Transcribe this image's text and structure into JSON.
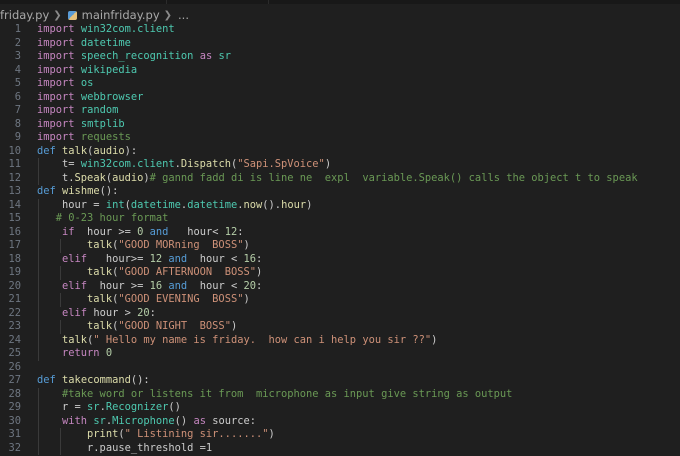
{
  "breadcrumb": {
    "folder": "friday.py",
    "file": "mainfriday.py",
    "more": "..."
  },
  "lines": [
    {
      "n": "1",
      "tokens": [
        [
          "kw",
          "import"
        ],
        [
          "",
          " "
        ],
        [
          "mod",
          "win32com.client"
        ]
      ]
    },
    {
      "n": "2",
      "tokens": [
        [
          "kw",
          "import"
        ],
        [
          "",
          " "
        ],
        [
          "mod",
          "datetime"
        ]
      ]
    },
    {
      "n": "3",
      "tokens": [
        [
          "kw",
          "import"
        ],
        [
          "",
          " "
        ],
        [
          "mod",
          "speech_recognition"
        ],
        [
          "",
          " "
        ],
        [
          "kw",
          "as"
        ],
        [
          "",
          " "
        ],
        [
          "mod",
          "sr"
        ]
      ]
    },
    {
      "n": "4",
      "tokens": [
        [
          "kw",
          "import"
        ],
        [
          "",
          " "
        ],
        [
          "mod",
          "wikipedia"
        ]
      ]
    },
    {
      "n": "5",
      "tokens": [
        [
          "kw",
          "import"
        ],
        [
          "",
          " "
        ],
        [
          "mod",
          "os"
        ]
      ]
    },
    {
      "n": "6",
      "tokens": [
        [
          "kw",
          "import"
        ],
        [
          "",
          " "
        ],
        [
          "mod",
          "webbrowser"
        ]
      ]
    },
    {
      "n": "7",
      "tokens": [
        [
          "kw",
          "import"
        ],
        [
          "",
          " "
        ],
        [
          "mod",
          "random"
        ]
      ]
    },
    {
      "n": "8",
      "tokens": [
        [
          "kw",
          "import"
        ],
        [
          "",
          " "
        ],
        [
          "mod",
          "smtplib"
        ]
      ]
    },
    {
      "n": "9",
      "tokens": [
        [
          "kw",
          "import"
        ],
        [
          "",
          " "
        ],
        [
          "cm",
          "requests"
        ]
      ]
    },
    {
      "n": "10",
      "tokens": [
        [
          "def",
          "def"
        ],
        [
          "",
          " "
        ],
        [
          "bi",
          "talk"
        ],
        [
          "",
          "("
        ],
        [
          "bi",
          "audio"
        ],
        [
          "",
          "):"
        ]
      ]
    },
    {
      "n": "11",
      "tokens": [
        [
          "",
          "    t= "
        ],
        [
          "mod",
          "win32com.client"
        ],
        [
          "",
          "."
        ],
        [
          "bi",
          "Dispatch"
        ],
        [
          "",
          "("
        ],
        [
          "st",
          "\"Sapi.SpVoice\""
        ],
        [
          "",
          ")"
        ]
      ]
    },
    {
      "n": "12",
      "tokens": [
        [
          "",
          "    t."
        ],
        [
          "bi",
          "Speak"
        ],
        [
          "",
          "("
        ],
        [
          "bi",
          "audio"
        ],
        [
          "",
          ")"
        ],
        [
          "cm",
          "# gannd fadd di is line ne  expl  variable.Speak() calls the object t to speak"
        ]
      ]
    },
    {
      "n": "13",
      "tokens": [
        [
          "def",
          "def"
        ],
        [
          "",
          " "
        ],
        [
          "bi",
          "wishme"
        ],
        [
          "",
          "():"
        ]
      ]
    },
    {
      "n": "14",
      "tokens": [
        [
          "",
          "    hour = "
        ],
        [
          "mod",
          "int"
        ],
        [
          "",
          "("
        ],
        [
          "mod",
          "datetime"
        ],
        [
          "",
          "."
        ],
        [
          "mod",
          "datetime"
        ],
        [
          "",
          "."
        ],
        [
          "bi",
          "now"
        ],
        [
          "",
          "()."
        ],
        [
          "bi",
          "hour"
        ],
        [
          "",
          ")"
        ]
      ]
    },
    {
      "n": "15",
      "tokens": [
        [
          "cm",
          "   # 0-23 hour format"
        ]
      ]
    },
    {
      "n": "16",
      "tokens": [
        [
          "",
          "    "
        ],
        [
          "kw",
          "if"
        ],
        [
          "",
          "  hour >= "
        ],
        [
          "num",
          "0"
        ],
        [
          "",
          " "
        ],
        [
          "def",
          "and"
        ],
        [
          "",
          "   hour< "
        ],
        [
          "num",
          "12"
        ],
        [
          "",
          ":"
        ]
      ]
    },
    {
      "n": "17",
      "tokens": [
        [
          "",
          "        "
        ],
        [
          "bi",
          "talk"
        ],
        [
          "",
          "("
        ],
        [
          "st",
          "\"GOOD MORning  BOSS\""
        ],
        [
          "",
          ")"
        ]
      ]
    },
    {
      "n": "18",
      "tokens": [
        [
          "",
          "    "
        ],
        [
          "kw",
          "elif"
        ],
        [
          "",
          "   hour>= "
        ],
        [
          "num",
          "12"
        ],
        [
          "",
          " "
        ],
        [
          "def",
          "and"
        ],
        [
          "",
          "  hour < "
        ],
        [
          "num",
          "16"
        ],
        [
          "",
          ":"
        ]
      ]
    },
    {
      "n": "19",
      "tokens": [
        [
          "",
          "        "
        ],
        [
          "bi",
          "talk"
        ],
        [
          "",
          "("
        ],
        [
          "st",
          "\"GOOD AFTERNOON  BOSS\""
        ],
        [
          "",
          ")"
        ]
      ]
    },
    {
      "n": "20",
      "tokens": [
        [
          "",
          "    "
        ],
        [
          "kw",
          "elif"
        ],
        [
          "",
          "  hour >= "
        ],
        [
          "num",
          "16"
        ],
        [
          "",
          " "
        ],
        [
          "def",
          "and"
        ],
        [
          "",
          "  hour < "
        ],
        [
          "num",
          "20"
        ],
        [
          "",
          ":"
        ]
      ]
    },
    {
      "n": "21",
      "tokens": [
        [
          "",
          "        "
        ],
        [
          "bi",
          "talk"
        ],
        [
          "",
          "("
        ],
        [
          "st",
          "\"GOOD EVENING  BOSS\""
        ],
        [
          "",
          ")"
        ]
      ]
    },
    {
      "n": "22",
      "tokens": [
        [
          "",
          "    "
        ],
        [
          "kw",
          "elif"
        ],
        [
          "",
          " hour > "
        ],
        [
          "num",
          "20"
        ],
        [
          "",
          ":"
        ]
      ]
    },
    {
      "n": "23",
      "tokens": [
        [
          "",
          "        "
        ],
        [
          "bi",
          "talk"
        ],
        [
          "",
          "("
        ],
        [
          "st",
          "\"GOOD NIGHT  BOSS\""
        ],
        [
          "",
          ")"
        ]
      ]
    },
    {
      "n": "24",
      "tokens": [
        [
          "",
          "    "
        ],
        [
          "bi",
          "talk"
        ],
        [
          "",
          "("
        ],
        [
          "st",
          "\" Hello my name is friday.  how can i help you sir ??\""
        ],
        [
          "",
          ")"
        ]
      ]
    },
    {
      "n": "25",
      "tokens": [
        [
          "",
          "    "
        ],
        [
          "kw",
          "return"
        ],
        [
          "",
          " "
        ],
        [
          "num",
          "0"
        ]
      ]
    },
    {
      "n": "26",
      "tokens": []
    },
    {
      "n": "27",
      "tokens": [
        [
          "def",
          "def"
        ],
        [
          "",
          " "
        ],
        [
          "bi",
          "takecommand"
        ],
        [
          "",
          "():"
        ]
      ]
    },
    {
      "n": "28",
      "tokens": [
        [
          "cm",
          "    #take word or listens it from  microphone as input give string as output"
        ]
      ]
    },
    {
      "n": "29",
      "tokens": [
        [
          "",
          "    r = "
        ],
        [
          "mod",
          "sr"
        ],
        [
          "",
          "."
        ],
        [
          "mod",
          "Recognizer"
        ],
        [
          "",
          "()"
        ]
      ]
    },
    {
      "n": "30",
      "tokens": [
        [
          "",
          "    "
        ],
        [
          "kw",
          "with"
        ],
        [
          "",
          " "
        ],
        [
          "mod",
          "sr"
        ],
        [
          "",
          "."
        ],
        [
          "mod",
          "Microphone"
        ],
        [
          "",
          "() "
        ],
        [
          "kw",
          "as"
        ],
        [
          "",
          " source:"
        ]
      ]
    },
    {
      "n": "31",
      "tokens": [
        [
          "",
          "        "
        ],
        [
          "bi",
          "print"
        ],
        [
          "",
          "("
        ],
        [
          "st",
          "\" Listining sir.......\""
        ],
        [
          "",
          ")"
        ]
      ]
    },
    {
      "n": "32",
      "tokens": [
        [
          "",
          "        r.pause_threshold =1"
        ]
      ]
    }
  ]
}
